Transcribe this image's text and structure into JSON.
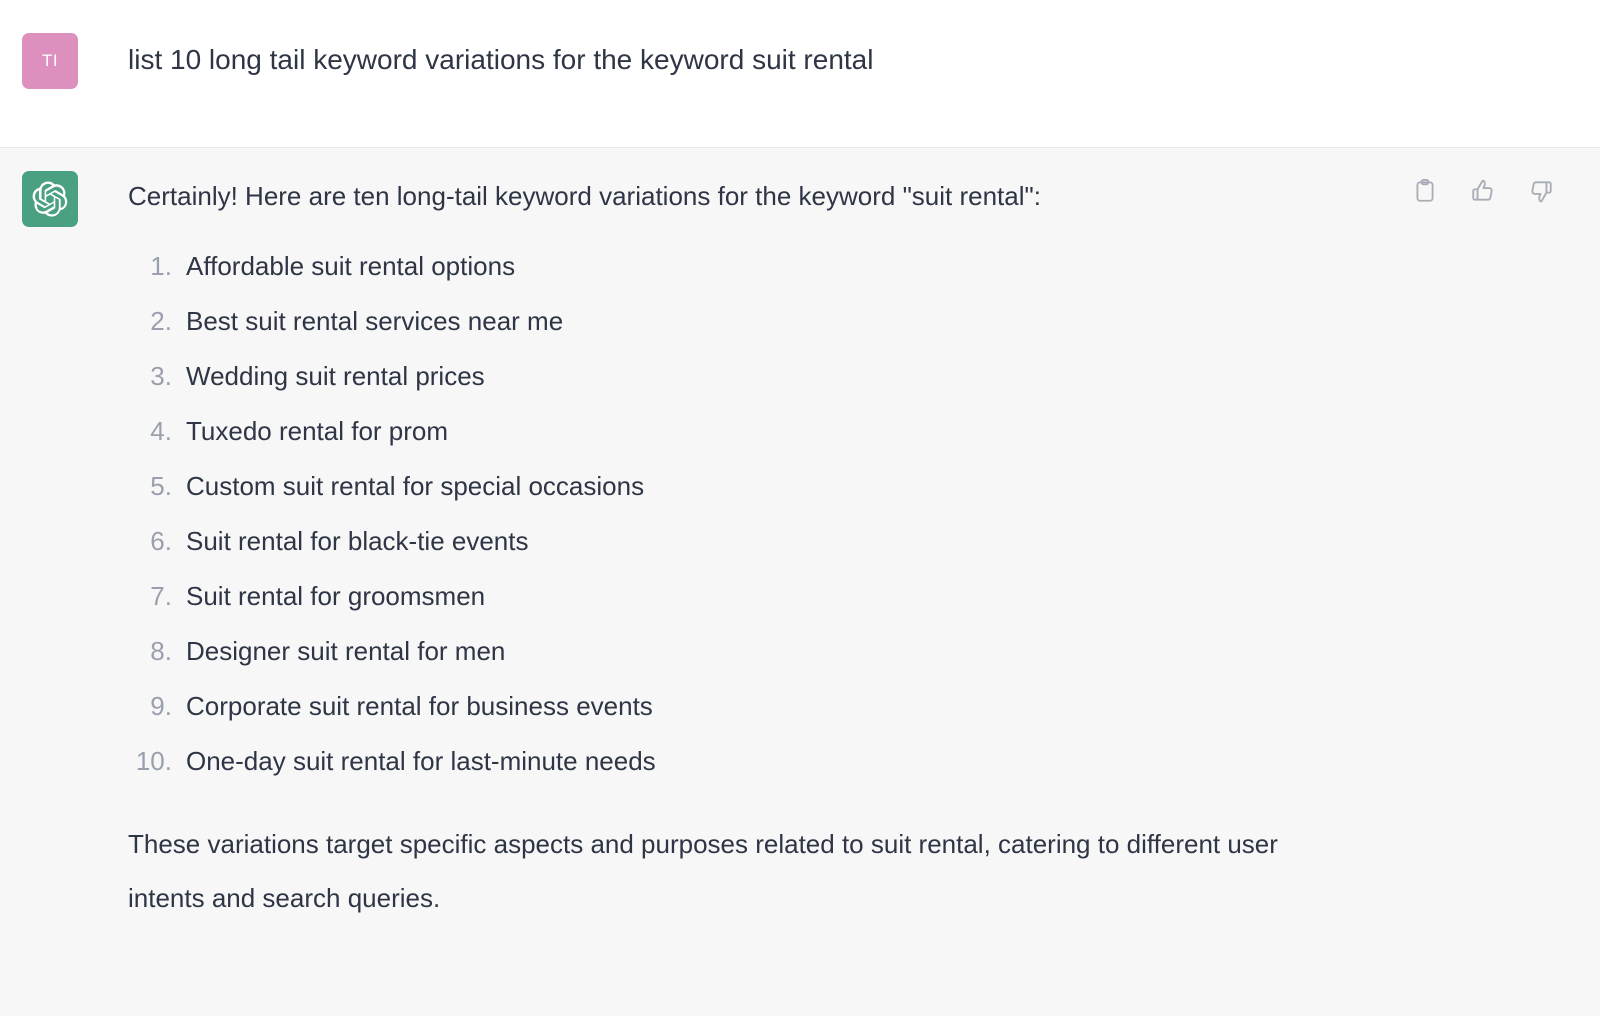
{
  "conversation": {
    "user_turn": {
      "avatar": {
        "initials": "TI",
        "icon_name": "user-avatar",
        "background_color": "#dd8fbe"
      },
      "message": "list 10 long tail keyword variations for the keyword suit rental"
    },
    "assistant_turn": {
      "avatar": {
        "icon_name": "chatgpt-logo",
        "background_color": "#4aa181"
      },
      "intro": "Certainly! Here are ten long-tail keyword variations for the keyword \"suit rental\":",
      "list_items": [
        "Affordable suit rental options",
        "Best suit rental services near me",
        "Wedding suit rental prices",
        "Tuxedo rental for prom",
        "Custom suit rental for special occasions",
        "Suit rental for black-tie events",
        "Suit rental for groomsmen",
        "Designer suit rental for men",
        "Corporate suit rental for business events",
        "One-day suit rental for last-minute needs"
      ],
      "outro": "These variations target specific aspects and purposes related to suit rental, catering to different user intents and search queries.",
      "actions": [
        {
          "icon_name": "copy-clipboard-icon",
          "label": "Copy"
        },
        {
          "icon_name": "thumbs-up-icon",
          "label": "Good response"
        },
        {
          "icon_name": "thumbs-down-icon",
          "label": "Bad response"
        }
      ]
    }
  },
  "colors": {
    "user_background": "#ffffff",
    "assistant_background": "#f7f7f8",
    "text": "#2e3544",
    "list_marker": "#9aa0ab",
    "icon": "#a9adb6",
    "divider": "#e8e8ec"
  }
}
